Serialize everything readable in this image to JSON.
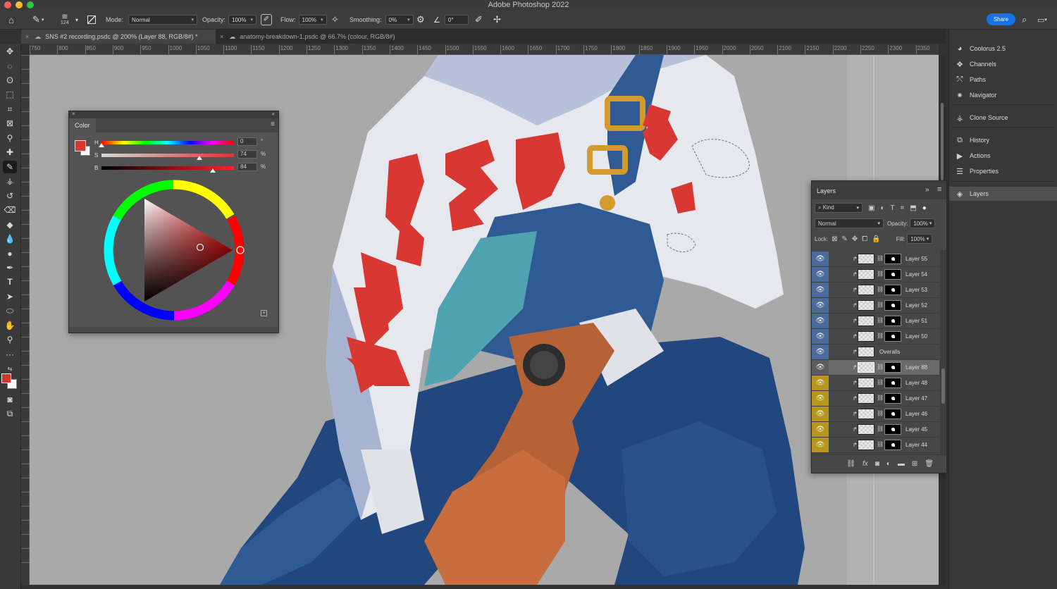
{
  "app_title": "Adobe Photoshop 2022",
  "options_bar": {
    "brush_size": "124",
    "mode_label": "Mode:",
    "mode_value": "Normal",
    "opacity_label": "Opacity:",
    "opacity_value": "100%",
    "flow_label": "Flow:",
    "flow_value": "100%",
    "smoothing_label": "Smoothing:",
    "smoothing_value": "0%",
    "angle_value": "0°",
    "share_label": "Share"
  },
  "tabs": [
    {
      "label": "SNS #2 recording.psdc @ 200% (Layer 88, RGB/8#) *",
      "close": "×"
    },
    {
      "label": "anatomy-breakdown-1.psdc @ 66.7% (colour, RGB/8#)",
      "close": "×"
    }
  ],
  "ruler_ticks": [
    "750",
    "800",
    "850",
    "900",
    "950",
    "1000",
    "1050",
    "1100",
    "1150",
    "1200",
    "1250",
    "1300",
    "1350",
    "1400",
    "1450",
    "1500",
    "1550",
    "1600",
    "1650",
    "1700",
    "1750",
    "1800",
    "1850",
    "1900",
    "1950",
    "2000",
    "2050",
    "2100",
    "2150",
    "2200",
    "2250",
    "2300",
    "2350"
  ],
  "color_panel": {
    "title": "Color",
    "h_label": "H",
    "h_value": "0",
    "h_unit": "°",
    "h_pos": 0.0,
    "s_label": "S",
    "s_value": "74",
    "s_unit": "%",
    "s_pos": 0.74,
    "b_label": "B",
    "b_value": "84",
    "b_unit": "%",
    "b_pos": 0.84,
    "foreground_color": "#d6382f"
  },
  "dock": {
    "items": [
      {
        "label": "Coolorus 2.5",
        "icon": "coolorus-icon"
      },
      {
        "label": "Channels",
        "icon": "channels-icon"
      },
      {
        "label": "Paths",
        "icon": "paths-icon"
      },
      {
        "label": "Navigator",
        "icon": "navigator-icon"
      },
      {
        "label": "Clone Source",
        "icon": "clone-source-icon"
      },
      {
        "label": "History",
        "icon": "history-icon"
      },
      {
        "label": "Actions",
        "icon": "actions-icon"
      },
      {
        "label": "Properties",
        "icon": "properties-icon"
      },
      {
        "label": "Layers",
        "icon": "layers-icon"
      }
    ]
  },
  "layers_panel": {
    "title": "Layers",
    "filter_value": "Kind",
    "blend_value": "Normal",
    "opacity_label": "Opacity:",
    "opacity_value": "100%",
    "lock_label": "Lock:",
    "fill_label": "Fill:",
    "fill_value": "100%",
    "layers": [
      {
        "name": "Layer 55",
        "tag_color": "#4a6b9b"
      },
      {
        "name": "Layer 54",
        "tag_color": "#4a6b9b"
      },
      {
        "name": "Layer 53",
        "tag_color": "#4a6b9b"
      },
      {
        "name": "Layer 52",
        "tag_color": "#4a6b9b"
      },
      {
        "name": "Layer 51",
        "tag_color": "#4a6b9b"
      },
      {
        "name": "Layer 50",
        "tag_color": "#4a6b9b"
      },
      {
        "name": "Overalls",
        "tag_color": "#4a6b9b"
      },
      {
        "name": "Layer 88",
        "tag_color": "#5c5c5c"
      },
      {
        "name": "Layer 48",
        "tag_color": "#b8961c"
      },
      {
        "name": "Layer 47",
        "tag_color": "#b8961c"
      },
      {
        "name": "Layer 46",
        "tag_color": "#b8961c"
      },
      {
        "name": "Layer 45",
        "tag_color": "#b8961c"
      },
      {
        "name": "Layer 44",
        "tag_color": "#b8961c"
      }
    ]
  },
  "colors": {
    "accent": "#1473e6",
    "shirt_red": "#d93832",
    "overall_blue": "#2f5a94",
    "jeans_blue": "#22467e",
    "skin": "#b66237",
    "shirt_white": "#e6e8ee",
    "shirt_shadow": "#a6b4d2",
    "teal": "#4fa3b0"
  }
}
